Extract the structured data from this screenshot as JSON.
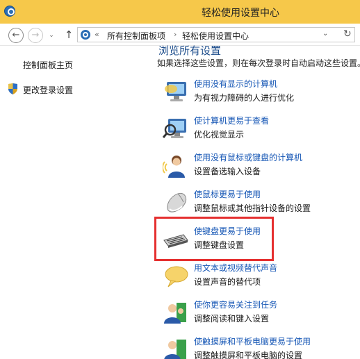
{
  "window": {
    "title": "轻松使用设置中心"
  },
  "nav": {
    "back_glyph": "←",
    "forward_glyph": "→",
    "history_glyph": "⌄",
    "up_glyph": "↑",
    "refresh_glyph": "↻",
    "breadcrumb": {
      "overflow": "«",
      "items": [
        "所有控制面板项",
        "轻松使用设置中心"
      ],
      "separator": "›",
      "dropdown_glyph": "⌄"
    }
  },
  "sidebar": {
    "items": [
      {
        "label": "控制面板主页",
        "icon": ""
      },
      {
        "label": "更改登录设置",
        "icon": "uac-shield-icon"
      }
    ]
  },
  "main": {
    "heading": "浏览所有设置",
    "description": "如果选择这些设置，则在每次登录时自动启动这些设置。",
    "items": [
      {
        "link": "使用没有显示的计算机",
        "desc": "为有视力障碍的人进行优化",
        "icon": "monitor-icon"
      },
      {
        "link": "使计算机更易于查看",
        "desc": "优化视觉显示",
        "icon": "magnifier-monitor-icon"
      },
      {
        "link": "使用没有鼠标或键盘的计算机",
        "desc": "设置备选输入设备",
        "icon": "user-speech-icon"
      },
      {
        "link": "使鼠标更易于使用",
        "desc": "调整鼠标或其他指针设备的设置",
        "icon": "mouse-icon"
      },
      {
        "link": "使键盘更易于使用",
        "desc": "调整键盘设置",
        "icon": "keyboard-icon"
      },
      {
        "link": "用文本或视频替代声音",
        "desc": "设置声音的替代项",
        "icon": "speech-bubble-icon"
      },
      {
        "link": "使你更容易关注到任务",
        "desc": "调整阅读和键入设置",
        "icon": "users-green-icon"
      },
      {
        "link": "使触摸屏和平板电脑更易于使用",
        "desc": "调整触摸屏和平板电脑的设置",
        "icon": "touch-tablet-icon"
      }
    ]
  },
  "colors": {
    "titlebar": "#f6c84a",
    "link": "#1556b5",
    "heading": "#1e4e8c",
    "highlight": "#e53030"
  }
}
